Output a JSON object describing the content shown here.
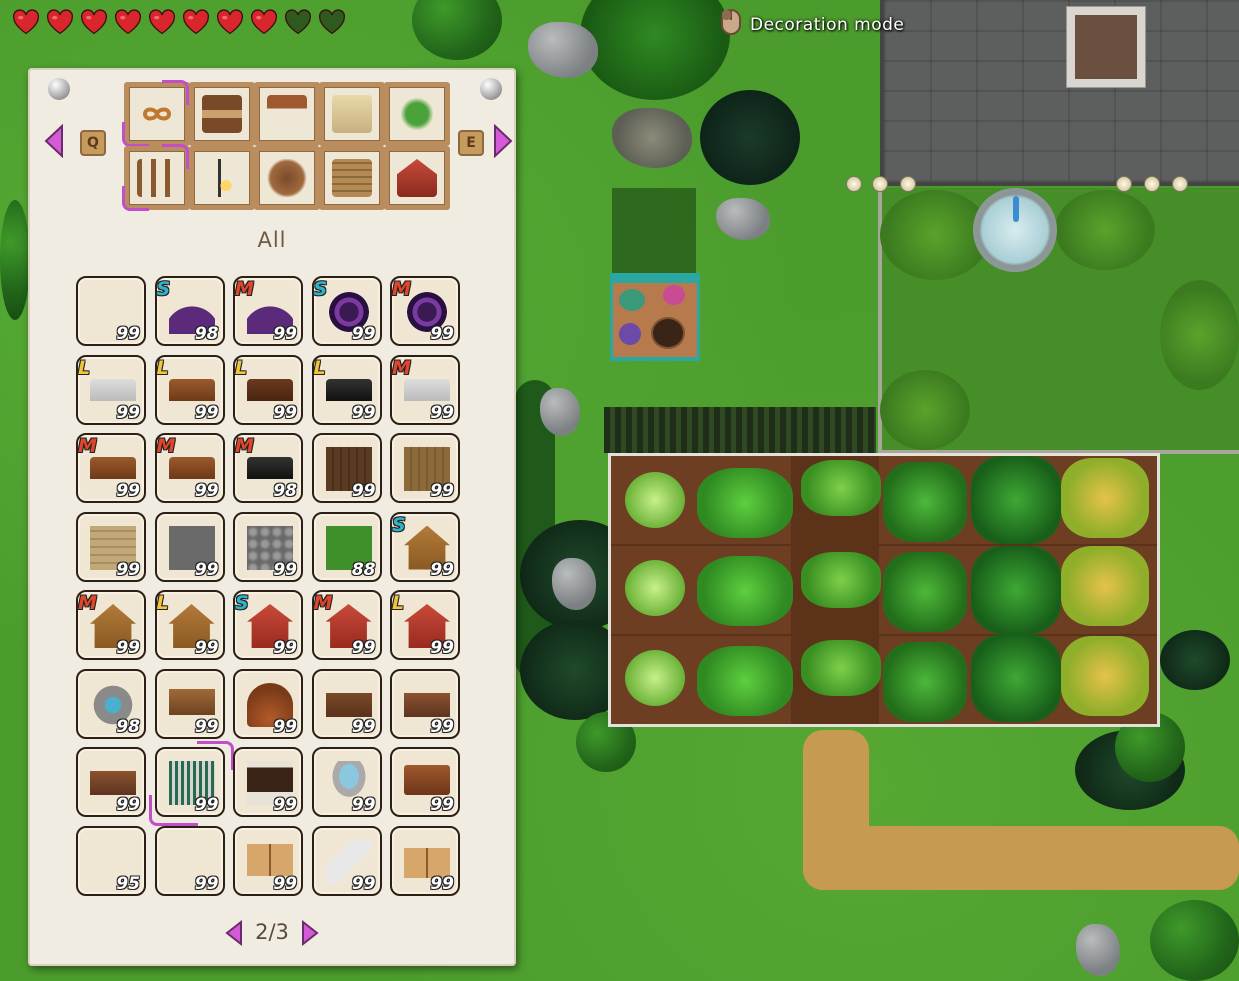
{
  "hud": {
    "hearts_full": 8,
    "hearts_total": 10,
    "mode_label": "Decoration mode",
    "mouse_icon": "mouse-icon"
  },
  "inventory": {
    "prev_key": "Q",
    "next_key": "E",
    "category_title": "All",
    "categories": [
      {
        "icon": "infinity-icon",
        "selected": true
      },
      {
        "icon": "workbench-icon"
      },
      {
        "icon": "table-icon"
      },
      {
        "icon": "book-quill-icon"
      },
      {
        "icon": "plant-icon"
      },
      {
        "icon": "fence-icon",
        "selected": true
      },
      {
        "icon": "lamp-post-icon"
      },
      {
        "icon": "rug-icon"
      },
      {
        "icon": "floor-tile-icon"
      },
      {
        "icon": "barn-icon"
      }
    ],
    "items": [
      {
        "badge": "",
        "qty": "99",
        "icon": "empty"
      },
      {
        "badge": "S",
        "qty": "98",
        "icon": "purple-rug-half"
      },
      {
        "badge": "M",
        "qty": "99",
        "icon": "purple-rug-half"
      },
      {
        "badge": "S",
        "qty": "99",
        "icon": "purple-rug-round"
      },
      {
        "badge": "M",
        "qty": "99",
        "icon": "purple-rug-round"
      },
      {
        "badge": "L",
        "qty": "99",
        "icon": "white-table"
      },
      {
        "badge": "L",
        "qty": "99",
        "icon": "wood-table"
      },
      {
        "badge": "L",
        "qty": "99",
        "icon": "dark-table"
      },
      {
        "badge": "L",
        "qty": "99",
        "icon": "black-table"
      },
      {
        "badge": "M",
        "qty": "99",
        "icon": "white-table"
      },
      {
        "badge": "M",
        "qty": "99",
        "icon": "wood-table"
      },
      {
        "badge": "M",
        "qty": "99",
        "icon": "wood-table"
      },
      {
        "badge": "M",
        "qty": "98",
        "icon": "black-table"
      },
      {
        "badge": "",
        "qty": "99",
        "icon": "dark-wood-floor"
      },
      {
        "badge": "",
        "qty": "99",
        "icon": "wood-floor"
      },
      {
        "badge": "",
        "qty": "99",
        "icon": "light-wood-floor"
      },
      {
        "badge": "",
        "qty": "99",
        "icon": "stone-floor"
      },
      {
        "badge": "",
        "qty": "99",
        "icon": "cobble-floor"
      },
      {
        "badge": "",
        "qty": "88",
        "icon": "grass-floor"
      },
      {
        "badge": "S",
        "qty": "99",
        "icon": "hut"
      },
      {
        "badge": "M",
        "qty": "99",
        "icon": "hut"
      },
      {
        "badge": "L",
        "qty": "99",
        "icon": "hut"
      },
      {
        "badge": "S",
        "qty": "99",
        "icon": "barn"
      },
      {
        "badge": "M",
        "qty": "99",
        "icon": "barn"
      },
      {
        "badge": "L",
        "qty": "99",
        "icon": "barn"
      },
      {
        "badge": "",
        "qty": "98",
        "icon": "stone-well"
      },
      {
        "badge": "",
        "qty": "99",
        "icon": "workbench"
      },
      {
        "badge": "",
        "qty": "99",
        "icon": "beehive"
      },
      {
        "badge": "",
        "qty": "99",
        "icon": "alchemy-table"
      },
      {
        "badge": "",
        "qty": "99",
        "icon": "potion-table"
      },
      {
        "badge": "",
        "qty": "99",
        "icon": "potion-table"
      },
      {
        "badge": "",
        "qty": "99",
        "icon": "loom",
        "selected": true
      },
      {
        "badge": "",
        "qty": "99",
        "icon": "planter-box"
      },
      {
        "badge": "",
        "qty": "99",
        "icon": "birdbath"
      },
      {
        "badge": "",
        "qty": "99",
        "icon": "chest"
      },
      {
        "badge": "",
        "qty": "95",
        "icon": "empty"
      },
      {
        "badge": "",
        "qty": "99",
        "icon": "empty"
      },
      {
        "badge": "",
        "qty": "99",
        "icon": "open-book"
      },
      {
        "badge": "",
        "qty": "99",
        "icon": "quill-ink"
      },
      {
        "badge": "",
        "qty": "99",
        "icon": "book-quill"
      }
    ],
    "page": "2/3"
  },
  "colors": {
    "badge_S": "#2fb3c9",
    "badge_M": "#e0462c",
    "badge_L": "#f2c53a",
    "heart_full": "#d8262c",
    "heart_empty": "#2f5a1e",
    "selection": "#c24ec9"
  }
}
